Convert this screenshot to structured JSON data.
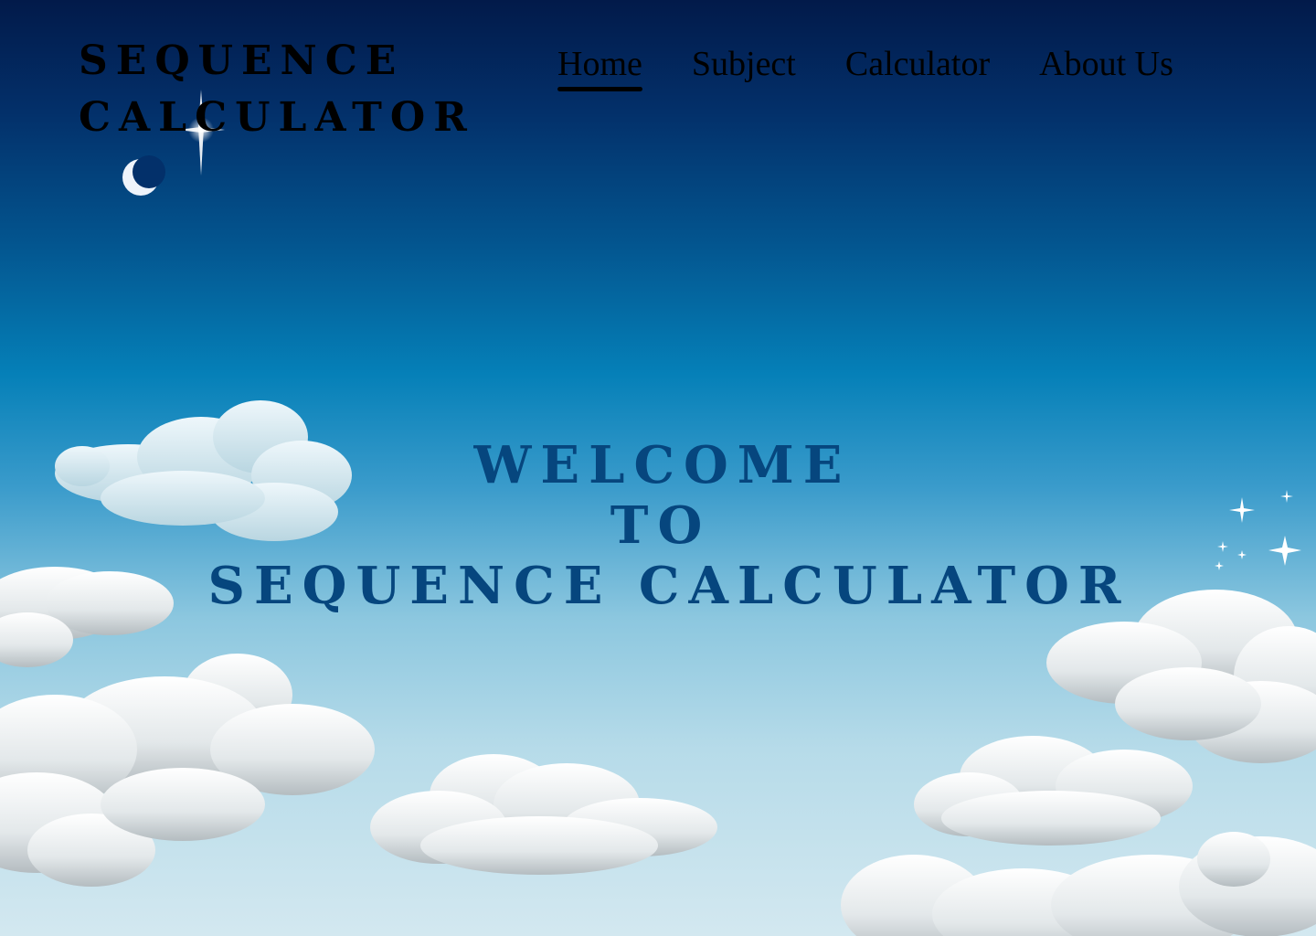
{
  "logo": {
    "line1": "Sequence",
    "line2": "Calculator"
  },
  "nav": {
    "items": [
      {
        "label": "Home",
        "active": true
      },
      {
        "label": "Subject",
        "active": false
      },
      {
        "label": "Calculator",
        "active": false
      },
      {
        "label": "About Us",
        "active": false
      }
    ]
  },
  "hero": {
    "line1": "Welcome",
    "line2": "to",
    "line3": "Sequence Calculator"
  },
  "colors": {
    "sky_top": "#021a4a",
    "sky_mid": "#0580b8",
    "sky_bottom": "#d3e8f0",
    "hero_text": "#06467e",
    "nav_text": "#000000"
  },
  "icons": {
    "crescent": "crescent-moon-icon",
    "star": "sparkle-star-icon",
    "cloud": "cloud-icon"
  }
}
